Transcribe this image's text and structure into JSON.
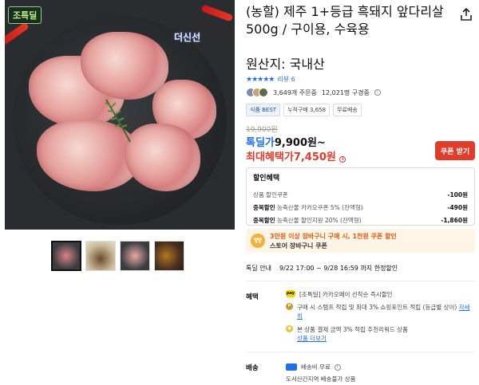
{
  "product": {
    "badge": "조특딜",
    "brand_watermark": "더신선",
    "title": "(농할) 제주 1+등급 흑돼지 앞다리살 500g / 구이용, 수육용",
    "origin": "원산지: 국내산",
    "stars": "★★★★★",
    "review_label": "리뷰 6",
    "order_count": "3,649개 주문중",
    "buyer_count": "12,021명 구경중",
    "tags": [
      "식품 BEST",
      "누적구매 3,658",
      "무료배송"
    ]
  },
  "price": {
    "original": "19,900원",
    "deal_label": "톡딜가",
    "deal_value": "9,900원~",
    "max_benefit_label": "최대혜택가",
    "max_benefit_value": "7,450원",
    "coupon_button": "쿠폰 받기"
  },
  "discount": {
    "title": "할인혜택",
    "lines": [
      {
        "label_bold": "",
        "label": "상품 할인쿠폰",
        "amount": "-100원"
      },
      {
        "label_bold": "중복할인",
        "label": "농축산물 카카오쿠폰 5% (잔액형)",
        "amount": "-490원"
      },
      {
        "label_bold": "중복할인",
        "label": "농축산물 할인지원 20% (잔액형)",
        "amount": "-1,860원"
      }
    ]
  },
  "cart_promo": {
    "line1": "3만원 이상 장바구니 구매 시, 1천원 쿠폰 할인",
    "line2": "스토어 장바구니 쿠폰"
  },
  "deal_info": {
    "label": "톡딜 안내",
    "value": "9/22 17:00 ~ 9/28 16:59 까지 한정할인"
  },
  "benefits": {
    "label": "혜택",
    "items": [
      {
        "icon": "pay",
        "text": "[조특딜] 카카오페이 선착순 즉시할인"
      },
      {
        "icon": "point",
        "text": "구매 시 스탬프 적립 및 최대 3% 쇼핑포인트 적립 (등급별 상이)",
        "link": "자세히"
      },
      {
        "icon": "coin",
        "text": "본 상품 결제 금액 3% 적립 추천리워드 상품",
        "link": "상품 더보기"
      }
    ]
  },
  "shipping": {
    "label": "배송",
    "line1": "배송비 무료",
    "line2": "도서산간지역 배송불가 상품"
  }
}
